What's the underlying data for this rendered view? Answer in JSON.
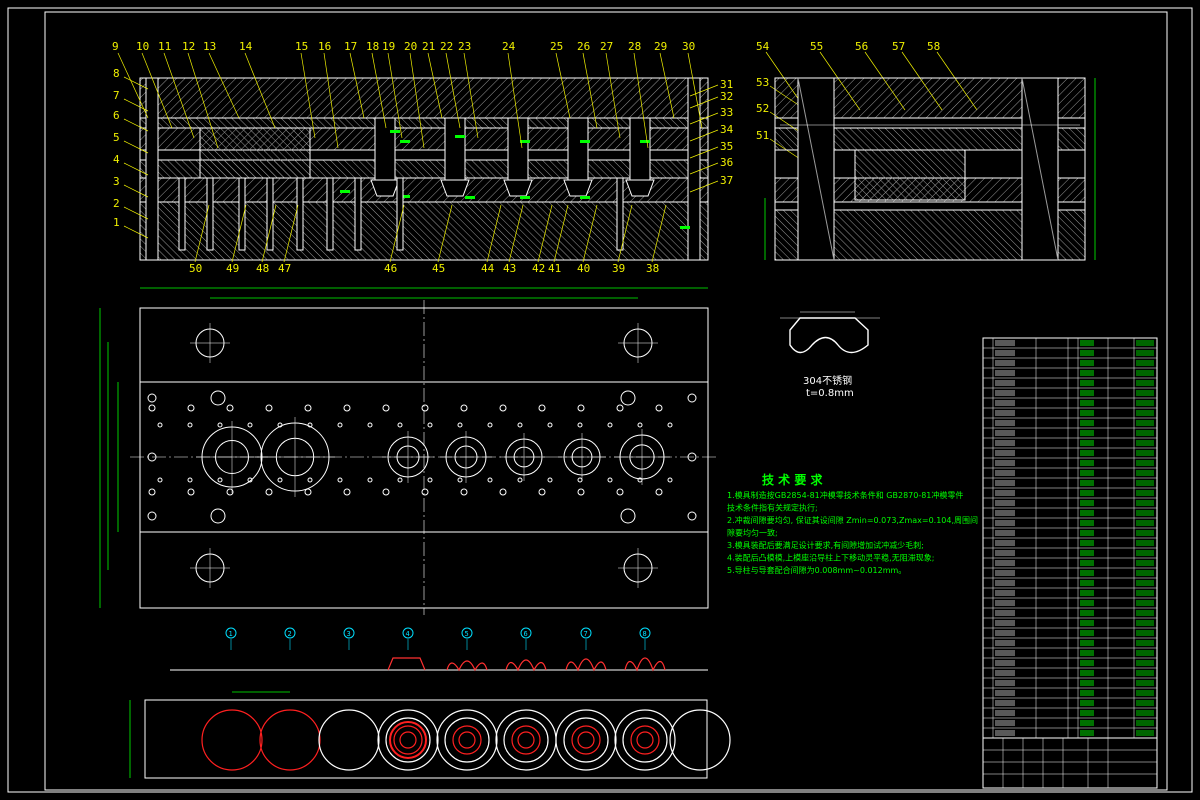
{
  "drawing": {
    "top_callouts": [
      "9",
      "10",
      "11",
      "12",
      "13",
      "14",
      "15",
      "16",
      "17",
      "18",
      "19",
      "20",
      "21",
      "22",
      "23",
      "24",
      "25",
      "26",
      "27",
      "28",
      "29",
      "30"
    ],
    "left_callouts": [
      "8",
      "7",
      "6",
      "5",
      "4",
      "3",
      "2",
      "1"
    ],
    "right_callouts": [
      "31",
      "32",
      "33",
      "34",
      "35",
      "36",
      "37"
    ],
    "bottom_callouts": [
      "50",
      "49",
      "48",
      "47",
      "46",
      "45",
      "44",
      "43",
      "42",
      "41",
      "40",
      "39",
      "38"
    ],
    "side_top_callouts": [
      "54",
      "55",
      "56",
      "57",
      "58"
    ],
    "side_left_callouts": [
      "53",
      "52",
      "51"
    ],
    "material_label": "304不锈钢",
    "thickness_label": "t=0.8mm",
    "tech_title": "技 术 要 求",
    "tech_lines": [
      "1.模具制造按GB2854-81冲模零技术条件和 GB2870-81冲模零件",
      "技术条件指有关规定执行;",
      "2.冲裁间隙要均匀, 保证其设间隙 Zmin=0.073,Zmax=0.104,周围间",
      "隙要均匀一致;",
      "3.模具装配后要满足设计要求,有间隙增加试冲减少毛刺;",
      "4.装配后凸模模,上模座沿导柱上下移动灵平稳,无阻滞现象;",
      "5.导柱与导套配合间隙为0.008mm~0.012mm。"
    ],
    "station_markers": [
      "1",
      "2",
      "3",
      "4",
      "5",
      "6",
      "7",
      "8"
    ],
    "bom_rows": 40
  },
  "colors": {
    "background": "#000000",
    "outline": "#ffffff",
    "callout": "#f0f000",
    "dimension": "#00ff00",
    "station": "#00e0ff",
    "strip_red": "#ff2020",
    "hatch": "#c8c8c8"
  }
}
